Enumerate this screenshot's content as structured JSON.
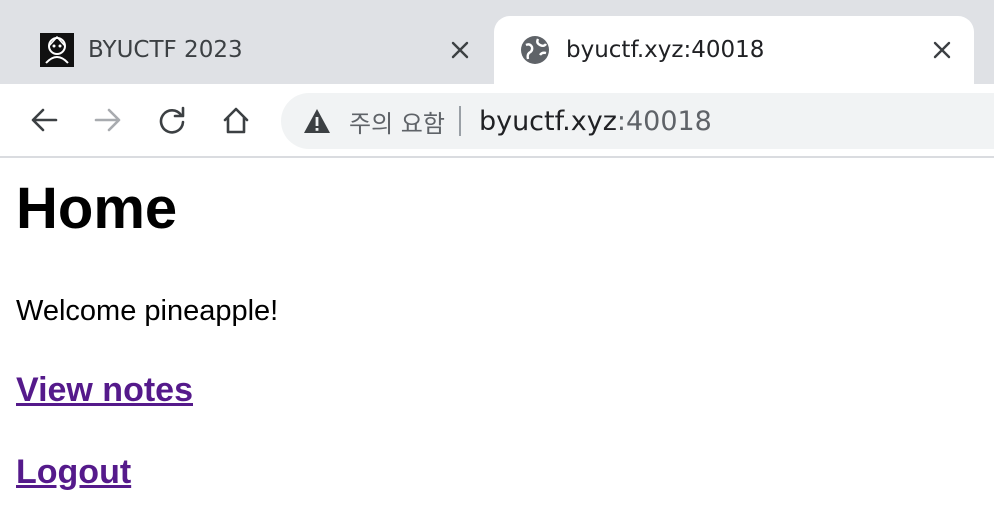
{
  "browser": {
    "tabs": [
      {
        "title": "BYUCTF 2023",
        "active": false,
        "favicon": "ctf-logo-icon"
      },
      {
        "title": "byuctf.xyz:40018",
        "active": true,
        "favicon": "globe-icon"
      }
    ],
    "toolbar": {
      "security_label": "주의 요함",
      "url_host": "byuctf.xyz",
      "url_port": ":40018"
    },
    "colors": {
      "tabstrip": "#dfe1e5",
      "omnibox": "#f1f3f4",
      "visited_link": "#551a8b"
    }
  },
  "page": {
    "title": "Home",
    "welcome": "Welcome pineapple!",
    "links": {
      "view_notes": "View notes",
      "logout": "Logout"
    }
  }
}
